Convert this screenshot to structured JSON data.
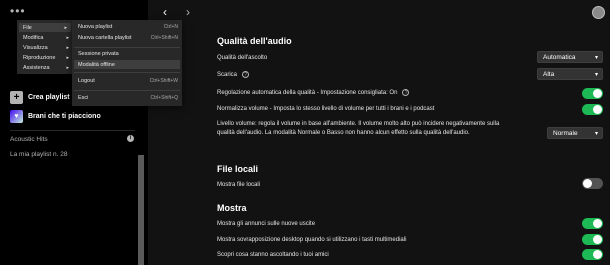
{
  "sidebar": {
    "more_glyph": "•••",
    "create_playlist": "Crea playlist",
    "liked_songs": "Brani che ti piacciono",
    "playlists": [
      "Acoustic Hits",
      "La mia playlist n. 28"
    ]
  },
  "main_menu": {
    "items": [
      "File",
      "Modifica",
      "Visualizza",
      "Riproduzione",
      "Assistenza"
    ]
  },
  "file_menu": {
    "items": [
      {
        "label": "Nuova playlist",
        "shortcut": "Ctrl+N"
      },
      {
        "label": "Nuova cartella playlist",
        "shortcut": "Ctrl+Shift+N"
      },
      {
        "label": "Sessione privata",
        "shortcut": ""
      },
      {
        "label": "Modalità offline",
        "shortcut": ""
      },
      {
        "label": "Logout",
        "shortcut": "Ctrl+Shift+W"
      },
      {
        "label": "Esci",
        "shortcut": "Ctrl+Shift+Q"
      }
    ]
  },
  "nav": {
    "back": "‹",
    "forward": "›"
  },
  "audio_quality": {
    "title": "Qualità dell'audio",
    "streaming_label": "Qualità dell'ascolto",
    "streaming_value": "Automatica",
    "download_label": "Scarica",
    "download_value": "Alta",
    "auto_adjust_label": "Regolazione automatica della qualità - Impostazione consigliata: On",
    "normalize_label": "Normalizza volume - Imposta lo stesso livello di volume per tutti i brani e i podcast",
    "volume_level_label": "Livello volume: regola il volume in base all'ambiente. Il volume molto alto può incidere negativamente sulla qualità dell'audio. La modalità Normale o Basso non hanno alcun effetto sulla qualità dell'audio.",
    "volume_level_value": "Normale"
  },
  "local_files": {
    "title": "File locali",
    "show_label": "Mostra file locali"
  },
  "display": {
    "title": "Mostra",
    "upcoming_ads_label": "Mostra gli annunci sulle nuove uscite",
    "overlay_label": "Mostra sovrapposizione desktop quando si utilizzano i tasti multimediali",
    "friends_label": "Scopri cosa stanno ascoltando i tuoi amici"
  },
  "colors": {
    "accent": "#1db954",
    "background": "#121212",
    "sidebar": "#000000",
    "menu": "#282828"
  }
}
